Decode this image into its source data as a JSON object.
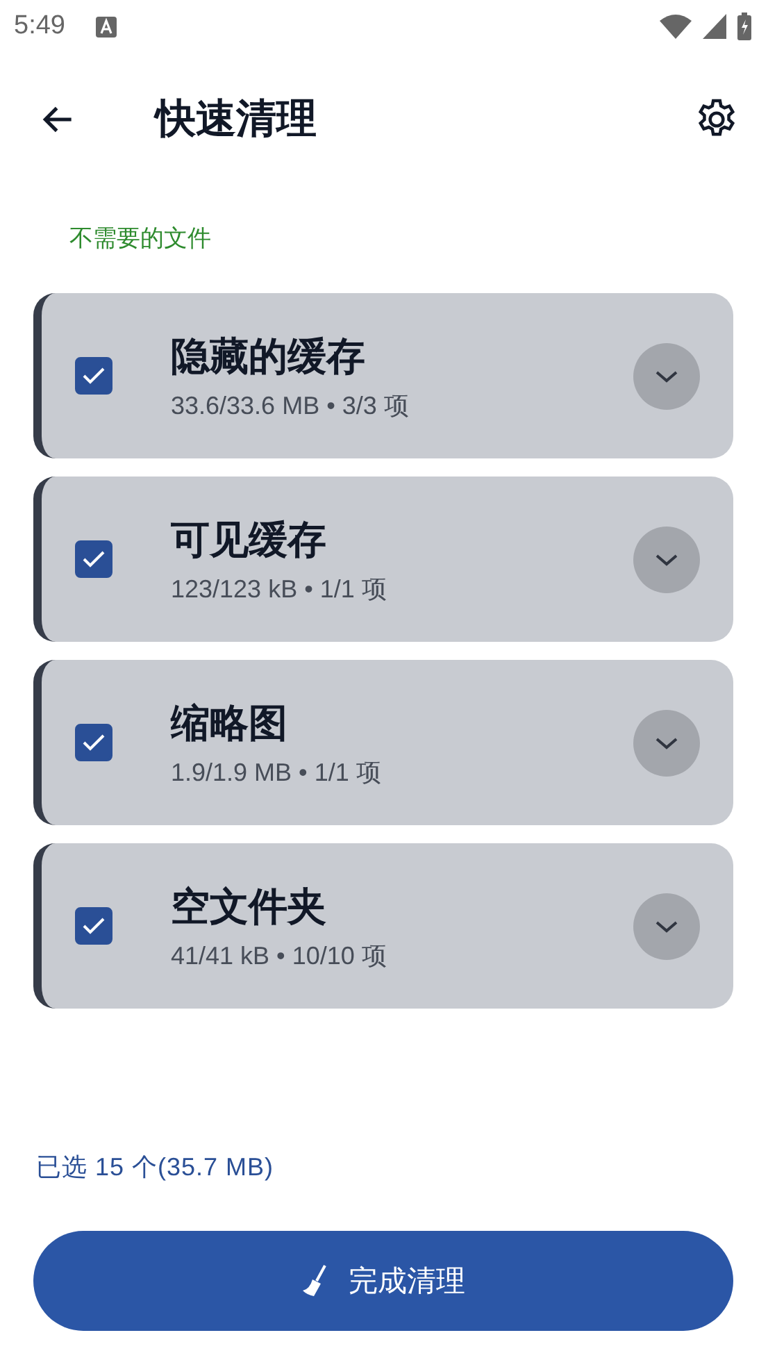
{
  "status_bar": {
    "time": "5:49"
  },
  "app_bar": {
    "title": "快速清理"
  },
  "section_label": "不需要的文件",
  "items": [
    {
      "title": "隐藏的缓存",
      "details": "33.6/33.6 MB • 3/3 项",
      "checked": true,
      "expanded": false
    },
    {
      "title": "可见缓存",
      "details": "123/123 kB • 1/1 项",
      "checked": true,
      "expanded": false
    },
    {
      "title": "缩略图",
      "details": "1.9/1.9 MB • 1/1 项",
      "checked": true,
      "expanded": false
    },
    {
      "title": "空文件夹",
      "details": "41/41 kB • 10/10 项",
      "checked": true,
      "expanded": false
    }
  ],
  "summary": "已选 15 个(35.7 MB)",
  "action_button": "完成清理"
}
